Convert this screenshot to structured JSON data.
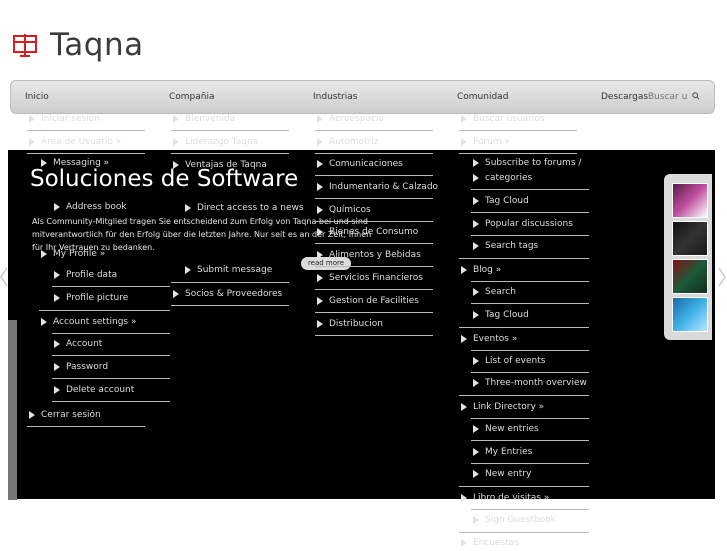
{
  "logo": {
    "text": "Taqna"
  },
  "nav": {
    "inicio": "Inicio",
    "compania": "Compañia",
    "industrias": "Industrias",
    "comunidad": "Comunidad",
    "descargas": "Descargas"
  },
  "search": {
    "placeholder": "Buscar usuar..."
  },
  "inicio_menu": {
    "iniciar_sesion": "Iniciar sesión",
    "area_usuario": "Área de Usuario »",
    "messaging": "Messaging »",
    "address_book": "Address book",
    "my_profile": "My Profile »",
    "profile_data": "Profile data",
    "profile_picture": "Profile picture",
    "account_settings": "Account settings »",
    "account": "Account",
    "password": "Password",
    "delete_account": "Delete account",
    "cerrar_sesion": "Cerrar sesión"
  },
  "compania_menu": {
    "bienvenida": "Bienvenida",
    "liderazgo": "Liderazgo Taqna",
    "ventajas": "Ventajas de Taqna",
    "direct_access": "Direct access to a news",
    "submit_message": "Submit message",
    "socios": "Socios & Proveedores"
  },
  "industrias_menu": {
    "aeroespacio": "Aeroespacio",
    "automotriz": "Automotriz",
    "comunicaciones": "Comunicaciones",
    "indumentaria": "Indumentario & Calzado",
    "quimicos": "Químicos",
    "bienes_consumo": "Bienes de Consumo",
    "alimentos": "Alimentos y Bebidas",
    "servicios_financieros": "Servicios Financieros",
    "gestion_facilities": "Gestion de Facilities",
    "distribucion": "Distribucion"
  },
  "comunidad_menu": {
    "buscar_usuarios": "Buscar usuarios",
    "forum": "Forum »",
    "subscribe_1": "Subscribe to forums /",
    "subscribe_2": "categories",
    "tag_cloud_1": "Tag Cloud",
    "popular_discussions": "Popular discussions",
    "search_tags": "Search tags",
    "blog": "Blog »",
    "search": "Search",
    "tag_cloud_2": "Tag Cloud",
    "eventos": "Eventos »",
    "list_events": "List of events",
    "three_month": "Three-month overview",
    "link_directory": "Link Directory »",
    "new_entries": "New entries",
    "my_entries": "My Entries",
    "new_entry": "New entry",
    "libro_visitas": "Libro de visitas »",
    "sign_guestbook": "Sign Guestbook",
    "encuestas": "Encuestas"
  },
  "slide": {
    "title": "Soluciones de Software",
    "text_1": "Als Community-Mitglied tragen Sie entscheidend zum Erfolg von Taqna bei und sind",
    "text_2": "mitverantwortlich für den Erfolg über die letzten Jahre. Nur seit es an der Zeit, Ihnen",
    "text_3": "für Ihr Vertrauen zu bedanken.",
    "read_more": "read more"
  }
}
